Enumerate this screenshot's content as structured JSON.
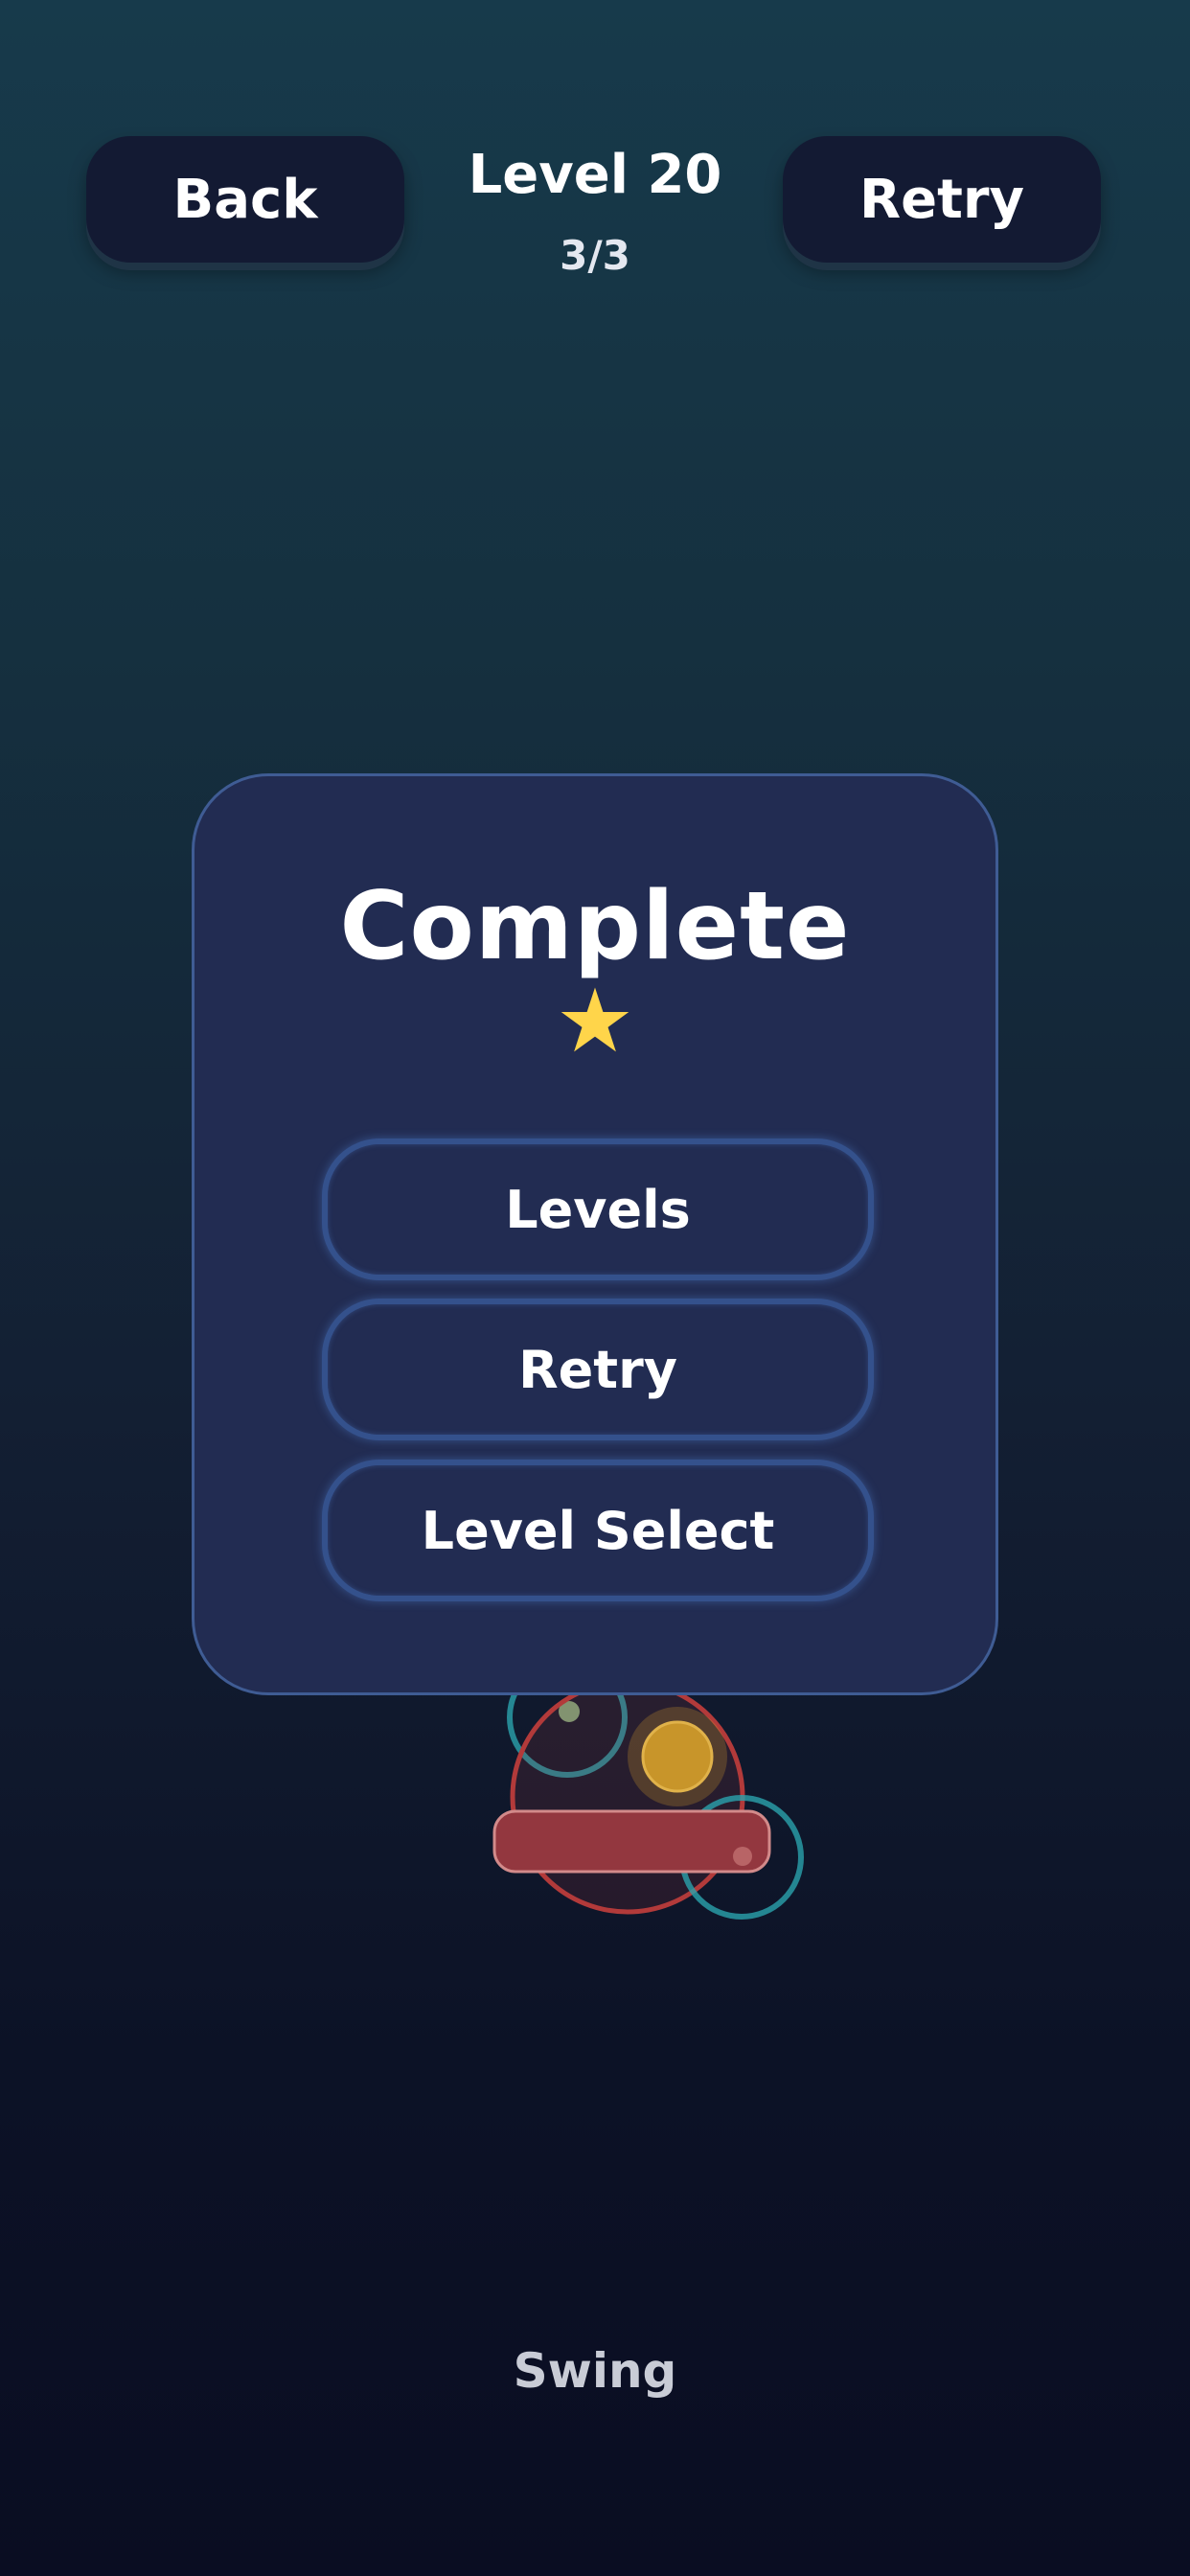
{
  "hud": {
    "back_label": "Back",
    "retry_label": "Retry",
    "level_title": "Level 20",
    "progress": "3/3"
  },
  "dialog": {
    "title": "Complete",
    "stars_earned": 1,
    "buttons": {
      "levels": "Levels",
      "retry": "Retry",
      "level_select": "Level Select"
    }
  },
  "footer": {
    "hint": "Swing"
  },
  "colors": {
    "panel": "#222c52",
    "panel_border": "#3f5c94",
    "star": "#ffd54a",
    "teal_ring": "#2aa3ad",
    "red_ring": "#b23a3a",
    "ball": "#d7a12a"
  }
}
